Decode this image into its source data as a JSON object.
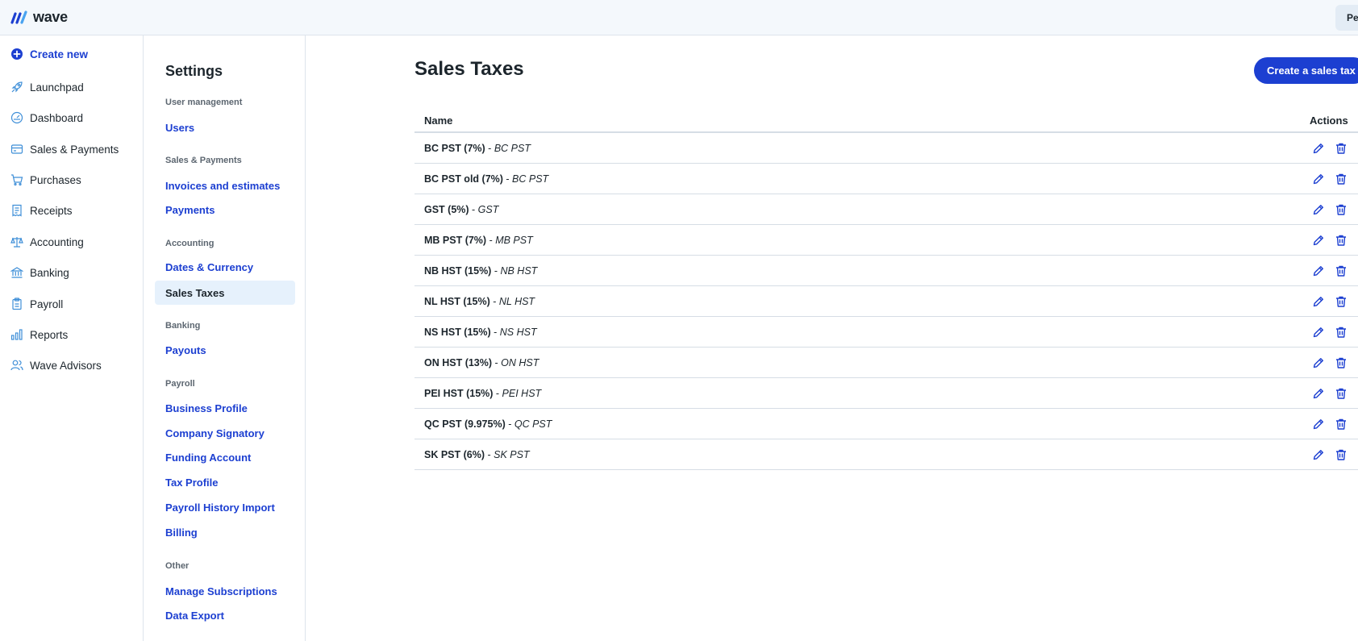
{
  "header": {
    "logo_text": "wave",
    "user_initials": "Pe"
  },
  "main_nav": {
    "create_new": "Create new",
    "items": [
      {
        "label": "Launchpad",
        "icon": "rocket-icon"
      },
      {
        "label": "Dashboard",
        "icon": "gauge-icon"
      },
      {
        "label": "Sales & Payments",
        "icon": "card-icon"
      },
      {
        "label": "Purchases",
        "icon": "cart-icon"
      },
      {
        "label": "Receipts",
        "icon": "receipt-icon"
      },
      {
        "label": "Accounting",
        "icon": "scales-icon"
      },
      {
        "label": "Banking",
        "icon": "bank-icon"
      },
      {
        "label": "Payroll",
        "icon": "clipboard-icon"
      },
      {
        "label": "Reports",
        "icon": "bar-chart-icon"
      },
      {
        "label": "Wave Advisors",
        "icon": "people-icon"
      }
    ]
  },
  "settings_nav": {
    "title": "Settings",
    "sections": [
      {
        "label": "User management",
        "links": [
          "Users"
        ]
      },
      {
        "label": "Sales & Payments",
        "links": [
          "Invoices and estimates",
          "Payments"
        ]
      },
      {
        "label": "Accounting",
        "links": [
          "Dates & Currency"
        ],
        "active": "Sales Taxes"
      },
      {
        "label": "Banking",
        "links": [
          "Payouts"
        ]
      },
      {
        "label": "Payroll",
        "links": [
          "Business Profile",
          "Company Signatory",
          "Funding Account",
          "Tax Profile",
          "Payroll History Import",
          "Billing"
        ]
      },
      {
        "label": "Other",
        "links": [
          "Manage Subscriptions",
          "Data Export"
        ]
      }
    ]
  },
  "content": {
    "title": "Sales Taxes",
    "create_button": "Create a sales tax",
    "columns": {
      "name": "Name",
      "actions": "Actions"
    },
    "separator": " - ",
    "rows": [
      {
        "name": "BC PST (7%)",
        "abbr": "BC PST"
      },
      {
        "name": "BC PST old (7%)",
        "abbr": "BC PST"
      },
      {
        "name": "GST (5%)",
        "abbr": "GST"
      },
      {
        "name": "MB PST (7%)",
        "abbr": "MB PST"
      },
      {
        "name": "NB HST (15%)",
        "abbr": "NB HST"
      },
      {
        "name": "NL HST (15%)",
        "abbr": "NL HST"
      },
      {
        "name": "NS HST (15%)",
        "abbr": "NS HST"
      },
      {
        "name": "ON HST (13%)",
        "abbr": "ON HST"
      },
      {
        "name": "PEI HST (15%)",
        "abbr": "PEI HST"
      },
      {
        "name": "QC PST (9.975%)",
        "abbr": "QC PST"
      },
      {
        "name": "SK PST (6%)",
        "abbr": "SK PST"
      }
    ]
  },
  "colors": {
    "brand_blue": "#1c3fd1",
    "active_bg": "#e6f1fc",
    "topbar_bg": "#f4f8fc"
  }
}
